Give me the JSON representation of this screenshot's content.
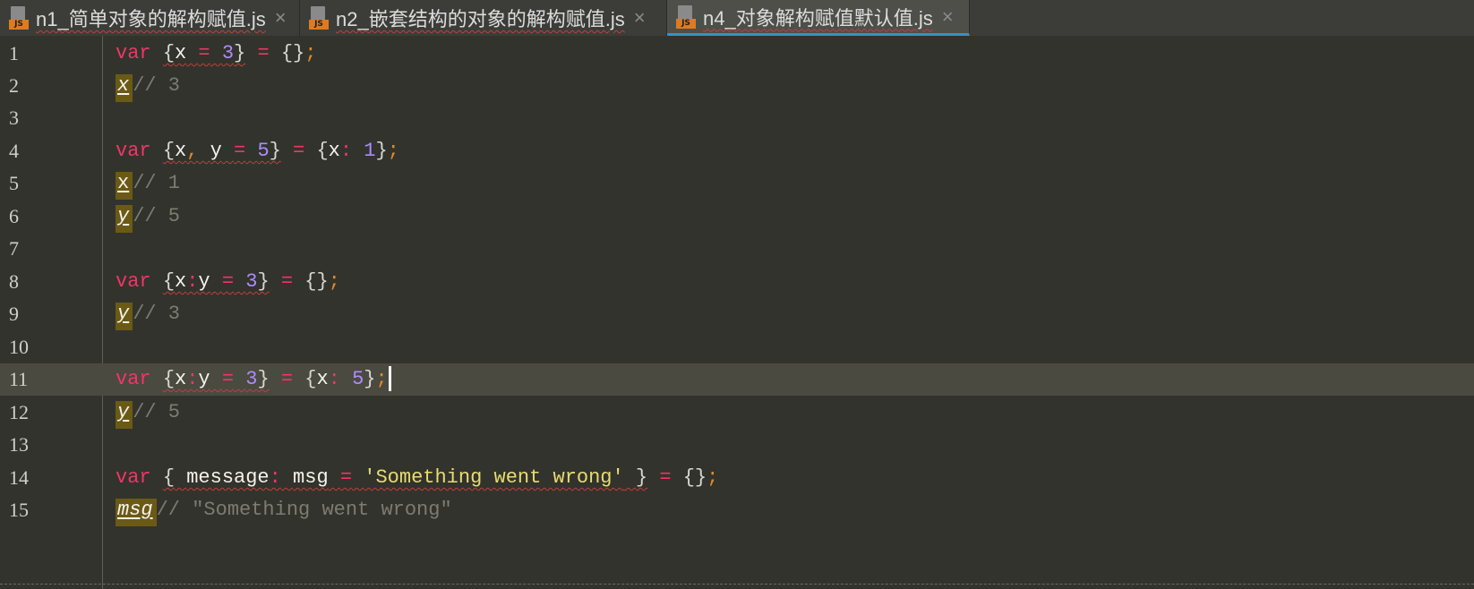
{
  "tabs": [
    {
      "icon": "js-file-icon",
      "badge": "JS",
      "label": "n1_简单对象的解构赋值.js",
      "close": "×"
    },
    {
      "icon": "js-file-icon",
      "badge": "JS",
      "label": "n2_嵌套结构的对象的解构赋值.js",
      "close": "×"
    },
    {
      "icon": "js-file-icon",
      "badge": "JS",
      "label": "n4_对象解构赋值默认值.js",
      "close": "×",
      "active": true
    }
  ],
  "line_numbers": [
    "1",
    "2",
    "3",
    "4",
    "5",
    "6",
    "7",
    "8",
    "9",
    "10",
    "11",
    "12",
    "13",
    "14",
    "15"
  ],
  "current_line": "11",
  "code": {
    "l1": {
      "kw": "var",
      "open": "{",
      "v": "x",
      "eq": "=",
      "n": "3",
      "close": "}",
      "eq2": "=",
      "rhs": "{}",
      "semi": ";"
    },
    "l2": {
      "v": "x",
      "c": "// 3"
    },
    "l4": {
      "kw": "var",
      "open": "{",
      "v1": "x",
      "comma": ",",
      "v2": "y",
      "eq": "=",
      "n": "5",
      "close": "}",
      "eq2": "=",
      "ro": "{",
      "rk": "x",
      "rc": ":",
      "rn": "1",
      "rcl": "}",
      "semi": ";"
    },
    "l5": {
      "v": "x",
      "c": "// 1"
    },
    "l6": {
      "v": "y",
      "c": "// 5"
    },
    "l8": {
      "kw": "var",
      "open": "{",
      "k": "x",
      "col": ":",
      "v": "y",
      "eq": "=",
      "n": "3",
      "close": "}",
      "eq2": "=",
      "rhs": "{}",
      "semi": ";"
    },
    "l9": {
      "v": "y",
      "c": "// 3"
    },
    "l11": {
      "kw": "var",
      "open": "{",
      "k": "x",
      "col": ":",
      "v": "y",
      "eq": "=",
      "n": "3",
      "close": "}",
      "eq2": "=",
      "ro": "{",
      "rk": "x",
      "rc": ":",
      "rn": "5",
      "rcl": "}",
      "semi": ";"
    },
    "l12": {
      "v": "y",
      "c": "// 5"
    },
    "l14": {
      "kw": "var",
      "open": "{",
      "k": "message",
      "col": ":",
      "v": "msg",
      "eq": "=",
      "s": "'Something went wrong'",
      "close": "}",
      "eq2": "=",
      "rhs": "{}",
      "semi": ";"
    },
    "l15": {
      "v": "msg",
      "c": "// \"Something went wrong\""
    }
  },
  "colors": {
    "keyword": "#f0356a",
    "number": "#ad8cff",
    "string": "#e8dc72",
    "comment": "#7c7c72",
    "highlight": "#6b5a16",
    "active_tab_accent": "#3a8fc3"
  }
}
